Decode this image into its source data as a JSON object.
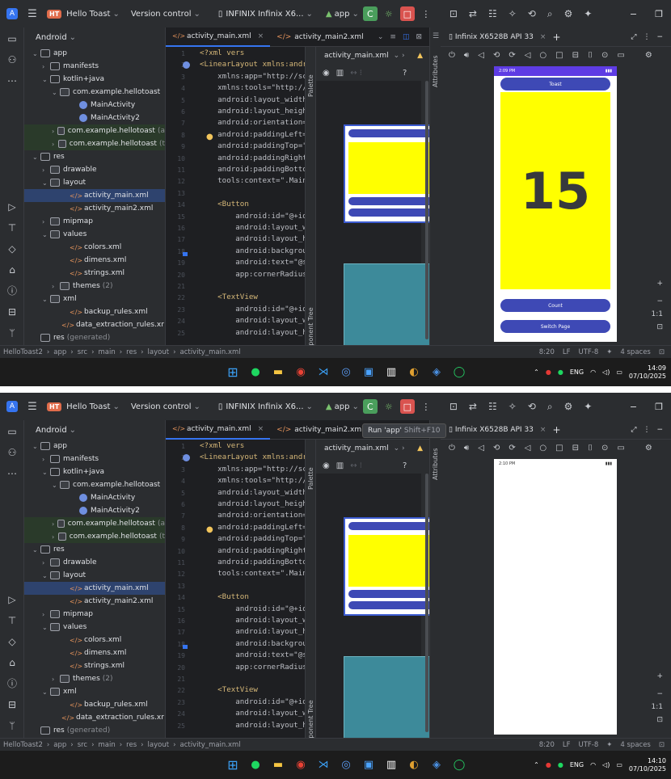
{
  "screens": [
    {
      "titlebar": {
        "logo": "A",
        "badge": "HT",
        "project": "Hello Toast",
        "vc": "Version control",
        "device": "INFINIX Infinix X6...",
        "run_config": "app"
      },
      "project_panel": {
        "header": "Android",
        "tree": [
          {
            "label": "app",
            "note": ""
          },
          {
            "label": "manifests",
            "note": ""
          },
          {
            "label": "kotlin+java",
            "note": ""
          },
          {
            "label": "com.example.hellotoast",
            "note": ""
          },
          {
            "label": "MainActivity",
            "note": ""
          },
          {
            "label": "MainActivity2",
            "note": ""
          },
          {
            "label": "com.example.hellotoast",
            "note": "(a"
          },
          {
            "label": "com.example.hellotoast",
            "note": "(t"
          },
          {
            "label": "res",
            "note": ""
          },
          {
            "label": "drawable",
            "note": ""
          },
          {
            "label": "layout",
            "note": ""
          },
          {
            "label": "activity_main.xml",
            "note": ""
          },
          {
            "label": "activity_main2.xml",
            "note": ""
          },
          {
            "label": "mipmap",
            "note": ""
          },
          {
            "label": "values",
            "note": ""
          },
          {
            "label": "colors.xml",
            "note": ""
          },
          {
            "label": "dimens.xml",
            "note": ""
          },
          {
            "label": "strings.xml",
            "note": ""
          },
          {
            "label": "themes",
            "note": "(2)"
          },
          {
            "label": "xml",
            "note": ""
          },
          {
            "label": "backup_rules.xml",
            "note": ""
          },
          {
            "label": "data_extraction_rules.xr",
            "note": ""
          },
          {
            "label": "res",
            "note": "(generated)"
          }
        ]
      },
      "editor": {
        "tabs": [
          "activity_main.xml",
          "activity_main2.xml"
        ],
        "line_numbers": [
          "1",
          "2",
          "3",
          "4",
          "5",
          "6",
          "7",
          "8",
          "9",
          "10",
          "11",
          "12",
          "13",
          "14",
          "15",
          "16",
          "17",
          "18",
          "19",
          "20",
          "21",
          "22",
          "23",
          "24",
          "25"
        ],
        "code": [
          "<?xml vers",
          "<LinearLayout xmlns:andr",
          "    xmlns:app=\"http://sc",
          "    xmlns:tools=\"http://",
          "    android:layout_width",
          "    android:layout_heigh",
          "    android:orientation=",
          "    android:paddingLeft=",
          "    android:paddingTop=\"",
          "    android:paddingRight",
          "    android:paddingBotto",
          "    tools:context=\".Main",
          "",
          "    <Button",
          "        android:id=\"@+id",
          "        android:layout_w",
          "        android:layout_h",
          "        android:backgrou",
          "        android:text=\"@s",
          "        app:cornerRadius",
          "",
          "    <TextView",
          "        android:id=\"@+id",
          "        android:layout_w",
          "        android:layout_h"
        ],
        "inspections": "4  1"
      },
      "design": {
        "file": "activity_main.xml",
        "palette": "Palette",
        "component_tree": "Component Tree",
        "attributes": "Attributes"
      },
      "running": {
        "tab": "Infinix X6528B API 33",
        "status_time": "2:09 PM",
        "toast_label": "Toast",
        "count": "15",
        "count_label": "Count",
        "switch_label": "Switch Page",
        "ratio": "1:1"
      },
      "statusbar": {
        "crumbs": [
          "HelloToast2",
          "app",
          "src",
          "main",
          "res",
          "layout",
          "activity_main.xml"
        ],
        "pos": "8:20",
        "lf": "LF",
        "enc": "UTF-8",
        "indent": "4 spaces"
      },
      "taskbar": {
        "lang": "ENG",
        "time": "14:09",
        "date": "07/10/2025"
      }
    },
    {
      "titlebar": {
        "logo": "A",
        "badge": "HT",
        "project": "Hello Toast",
        "vc": "Version control",
        "device": "INFINIX Infinix X6...",
        "run_config": "app"
      },
      "tooltip": {
        "text": "Run 'app'",
        "shortcut": "Shift+F10"
      },
      "running": {
        "tab": "Infinix X6528B API 33",
        "status_time": "2:10 PM",
        "ratio": "1:1"
      },
      "statusbar": {
        "crumbs": [
          "HelloToast2",
          "app",
          "src",
          "main",
          "res",
          "layout",
          "activity_main.xml"
        ],
        "pos": "8:20",
        "lf": "LF",
        "enc": "UTF-8",
        "indent": "4 spaces"
      },
      "taskbar": {
        "lang": "ENG",
        "time": "14:10",
        "date": "07/10/2025"
      }
    }
  ],
  "colors": {
    "accent": "#3574f0",
    "ide_bg": "#1e1f22",
    "panel_bg": "#2b2d30",
    "phone_button": "#3e49b5",
    "phone_yellow": "#ffff00"
  }
}
